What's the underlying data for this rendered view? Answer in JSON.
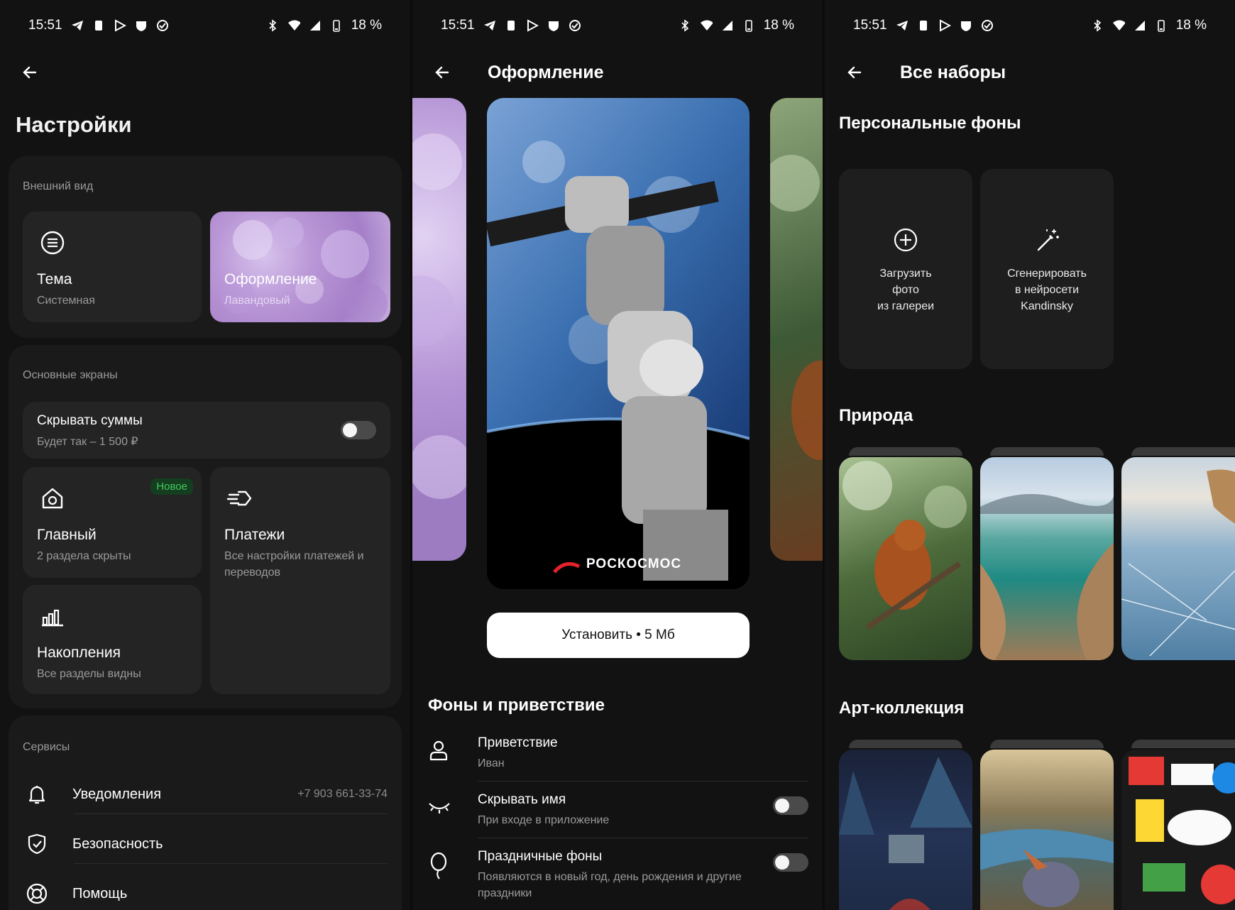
{
  "status_bar": {
    "time": "15:51",
    "battery": "18 %"
  },
  "screen1": {
    "title": "Настройки",
    "appearance": {
      "label": "Внешний вид",
      "theme": {
        "title": "Тема",
        "subtitle": "Системная"
      },
      "design": {
        "title": "Оформление",
        "subtitle": "Лавандовый"
      }
    },
    "main_screens": {
      "label": "Основные экраны",
      "hide_sums": {
        "title": "Скрывать суммы",
        "subtitle": "Будет так – 1 500 ₽"
      },
      "home": {
        "title": "Главный",
        "subtitle": "2 раздела скрыты",
        "badge": "Новое"
      },
      "payments": {
        "title": "Платежи",
        "subtitle": "Все настройки платежей и переводов"
      },
      "savings": {
        "title": "Накопления",
        "subtitle": "Все разделы видны"
      }
    },
    "services": {
      "label": "Сервисы",
      "items": [
        {
          "label": "Уведомления",
          "value": "+7 903 661-33-74",
          "icon": "bell-icon"
        },
        {
          "label": "Безопасность",
          "value": "",
          "icon": "shield-icon"
        },
        {
          "label": "Помощь",
          "value": "",
          "icon": "lifebuoy-icon"
        }
      ]
    }
  },
  "screen2": {
    "title": "Оформление",
    "wallpaper_brand": "РОСКОСМОС",
    "install_button": "Установить • 5 Мб",
    "section_title": "Фоны и приветствие",
    "rows": [
      {
        "title": "Приветствие",
        "subtitle": "Иван",
        "icon": "person-icon"
      },
      {
        "title": "Скрывать имя",
        "subtitle": "При входе в приложение",
        "icon": "closed-eye-icon",
        "toggle": false
      },
      {
        "title": "Праздничные фоны",
        "subtitle": "Появляются в новый год, день рождения и другие праздники",
        "icon": "balloon-icon",
        "toggle": false
      }
    ]
  },
  "screen3": {
    "title": "Все наборы",
    "personal": {
      "title": "Персональные фоны",
      "upload": "Загрузить\nфото\nиз галереи",
      "generate": "Сгенерировать\nв нейросети\nKandinsky"
    },
    "nature_title": "Природа",
    "art_title": "Арт-коллекция"
  },
  "colors": {
    "background": "#121212",
    "card": "#242424",
    "lavender": "#b996d6",
    "new_badge": "#3ecb5e"
  }
}
